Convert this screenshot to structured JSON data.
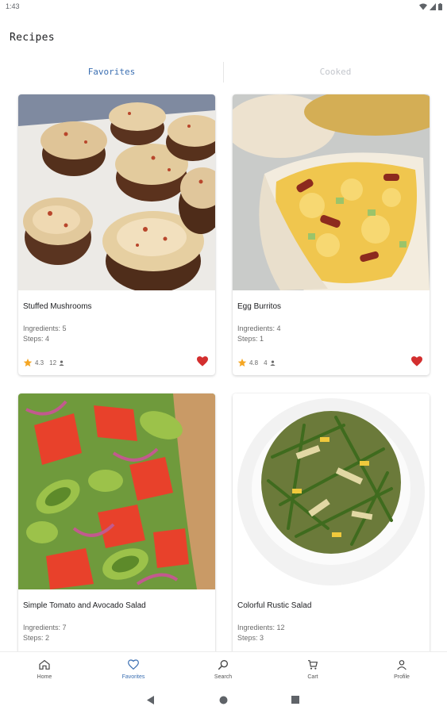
{
  "status": {
    "time": "1:43"
  },
  "app": {
    "title": "Recipes"
  },
  "tabs": [
    {
      "label": "Favorites",
      "active": true
    },
    {
      "label": "Cooked",
      "active": false
    }
  ],
  "recipes": [
    {
      "title": "Stuffed Mushrooms",
      "ingredients": "Ingredients: 5",
      "steps": "Steps: 4",
      "rating": "4.3",
      "reviews": "12",
      "favorite": true
    },
    {
      "title": "Egg Burritos",
      "ingredients": "Ingredients: 4",
      "steps": "Steps: 1",
      "rating": "4.8",
      "reviews": "4",
      "favorite": true
    },
    {
      "title": "Simple Tomato and Avocado Salad",
      "ingredients": "Ingredients: 7",
      "steps": "Steps: 2"
    },
    {
      "title": "Colorful Rustic Salad",
      "ingredients": "Ingredients: 12",
      "steps": "Steps: 3"
    }
  ],
  "nav": [
    {
      "label": "Home",
      "icon": "home-icon"
    },
    {
      "label": "Favorites",
      "icon": "heart-outline-icon",
      "active": true
    },
    {
      "label": "Search",
      "icon": "search-icon"
    },
    {
      "label": "Cart",
      "icon": "cart-icon"
    },
    {
      "label": "Profile",
      "icon": "profile-icon"
    }
  ],
  "colors": {
    "accent": "#3b6fb2",
    "heart": "#d32f2f",
    "star": "#f5a623",
    "inactive_tab": "#c3c6cc"
  }
}
